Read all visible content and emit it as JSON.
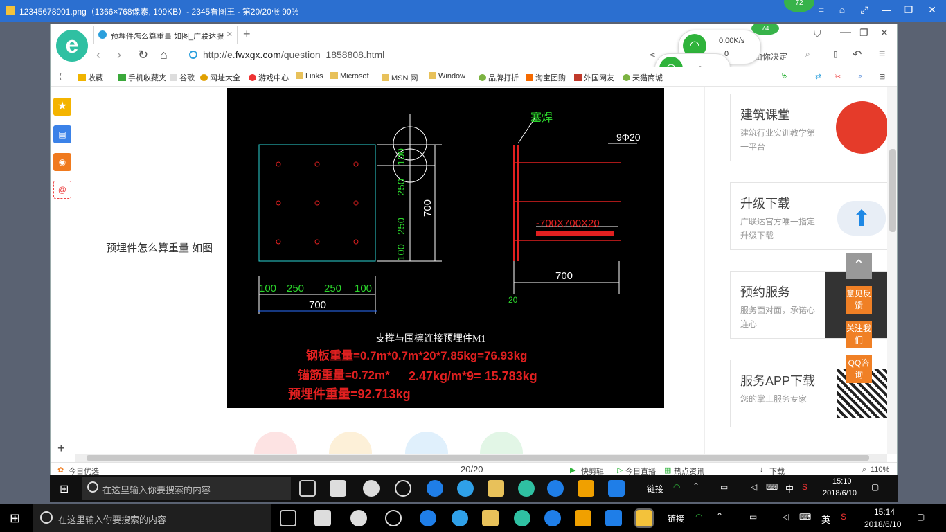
{
  "viewer": {
    "title": "12345678901.png（1366×768像素, 199KB）- 2345看图王 - 第20/20张 90%",
    "badge_top": "72"
  },
  "browser": {
    "tab_title": "预埋件怎么算重量 如图_广联达服",
    "url_prefix": "http://e.",
    "url_domain": "fwxgx.com",
    "url_path": "/question_1858808.html",
    "search_hint": "由你决定",
    "wifi": {
      "speed": "0.00K/s",
      "count1": "0",
      "count2": "0",
      "badge": "74"
    },
    "bookmarks": [
      {
        "label": "收藏",
        "color": "#f0b400"
      },
      {
        "label": "手机收藏夹",
        "color": "#3aa83a"
      },
      {
        "label": "谷歌",
        "color": "#bbbbbb"
      },
      {
        "label": "网址大全",
        "color": "#e0a000"
      },
      {
        "label": "游戏中心",
        "color": "#e33"
      },
      {
        "label": "Links",
        "color": "#e8c15a"
      },
      {
        "label": "Microsof",
        "color": "#e8c15a"
      },
      {
        "label": "MSN 网",
        "color": "#e8c15a"
      },
      {
        "label": "Window",
        "color": "#e8c15a"
      },
      {
        "label": "品牌打折",
        "color": "#7cb342"
      },
      {
        "label": "淘宝团购",
        "color": "#f56a00"
      },
      {
        "label": "外国网友",
        "color": "#c0392b"
      },
      {
        "label": "天猫商城",
        "color": "#7cb342"
      }
    ],
    "status": {
      "today": "今日优选",
      "page": "20/20",
      "clip": "快剪辑",
      "live": "今日直播",
      "news": "热点资讯",
      "download": "下载",
      "zoom": "110%"
    }
  },
  "page": {
    "question": "预埋件怎么算重量  如图",
    "cad": {
      "weld_label": "塞焊",
      "bar_label": "9Φ20",
      "plate_label": "-700X700X20",
      "dims_bottom": [
        "100",
        "250",
        "250",
        "100"
      ],
      "dim_total": "700",
      "dims_side": [
        "100",
        "250",
        "250",
        "100"
      ],
      "dim_side_total": "700",
      "dim_right": "700",
      "dim_thick": "20",
      "caption": "支撑与围檩连接预埋件M1",
      "calc1": "钢板重量=0.7m*0.7m*20*7.85kg=76.93kg",
      "calc2_a": "锚筋重量=0.72m*",
      "calc2_b": "2.47kg/m*9= 15.783kg",
      "calc3": "预埋件重量=92.713kg"
    },
    "cards": [
      {
        "title": "建筑课堂",
        "sub": "建筑行业实训教学第一平台"
      },
      {
        "title": "升级下载",
        "sub": "广联达官方唯一指定升级下载"
      },
      {
        "title": "预约服务",
        "sub": "服务面对面，承诺心连心"
      },
      {
        "title": "服务APP下载",
        "sub": "您的掌上服务专家"
      }
    ],
    "float_buttons": [
      "意见反馈",
      "关注我们",
      "QQ咨询"
    ]
  },
  "taskbar_inner": {
    "search": "在这里输入你要搜索的内容",
    "link": "链接",
    "ime1": "中",
    "time": "15:10",
    "date": "2018/6/10"
  },
  "taskbar_outer": {
    "search": "在这里输入你要搜索的内容",
    "link": "链接",
    "ime1": "英",
    "time": "15:14",
    "date": "2018/6/10"
  }
}
